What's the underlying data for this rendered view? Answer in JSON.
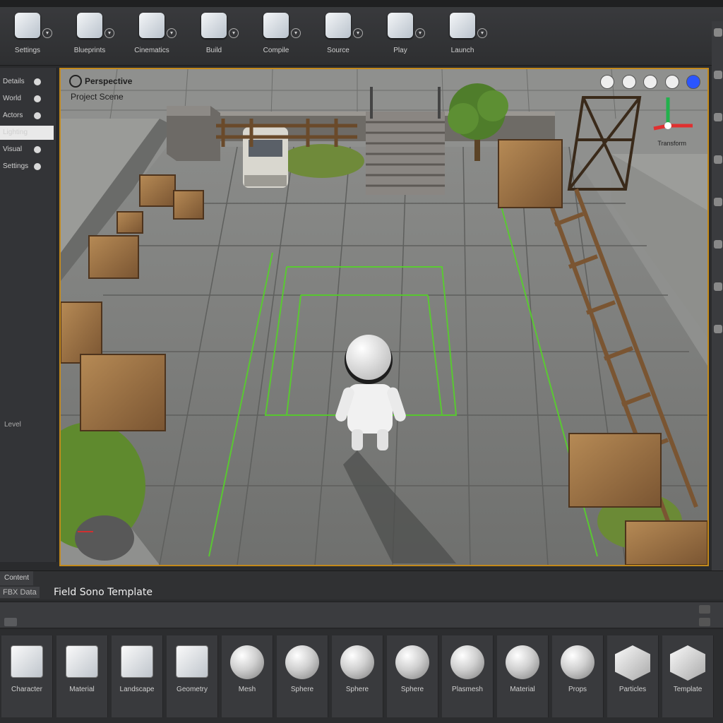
{
  "toolbar": {
    "items": [
      {
        "label": "Settings",
        "icon": "mode-icon"
      },
      {
        "label": "Blueprints",
        "icon": "blueprint-icon"
      },
      {
        "label": "Cinematics",
        "icon": "cinematics-icon"
      },
      {
        "label": "Build",
        "icon": "build-icon"
      },
      {
        "label": "Compile",
        "icon": "compile-icon"
      },
      {
        "label": "Source",
        "icon": "source-icon"
      },
      {
        "label": "Play",
        "icon": "play-icon"
      },
      {
        "label": "Launch",
        "icon": "launch-icon"
      }
    ]
  },
  "left_panel": {
    "rows": [
      "Details",
      "World",
      "Actors",
      "Lighting",
      "Visual",
      "Settings"
    ],
    "footer": "Level"
  },
  "viewport": {
    "title": "Perspective",
    "subtitle": "Project Scene",
    "gizmo_label": "Transform",
    "accent": "#c38a1c",
    "grid_color": "#56d12a"
  },
  "content_browser": {
    "tab_label": "Content",
    "sub_label": "FBX Data",
    "title": "Field Sono Template",
    "assets": [
      {
        "name": "Character",
        "shape": "card"
      },
      {
        "name": "Material",
        "shape": "card"
      },
      {
        "name": "Landscape",
        "shape": "card"
      },
      {
        "name": "Geometry",
        "shape": "card"
      },
      {
        "name": "Mesh",
        "shape": "sphere"
      },
      {
        "name": "Sphere",
        "shape": "sphere"
      },
      {
        "name": "Sphere",
        "shape": "sphere"
      },
      {
        "name": "Sphere",
        "shape": "sphere"
      },
      {
        "name": "Plasmesh",
        "shape": "sphere"
      },
      {
        "name": "Material",
        "shape": "sphere"
      },
      {
        "name": "Props",
        "shape": "sphere"
      },
      {
        "name": "Particles",
        "shape": "hex"
      },
      {
        "name": "Template",
        "shape": "hex"
      }
    ]
  }
}
